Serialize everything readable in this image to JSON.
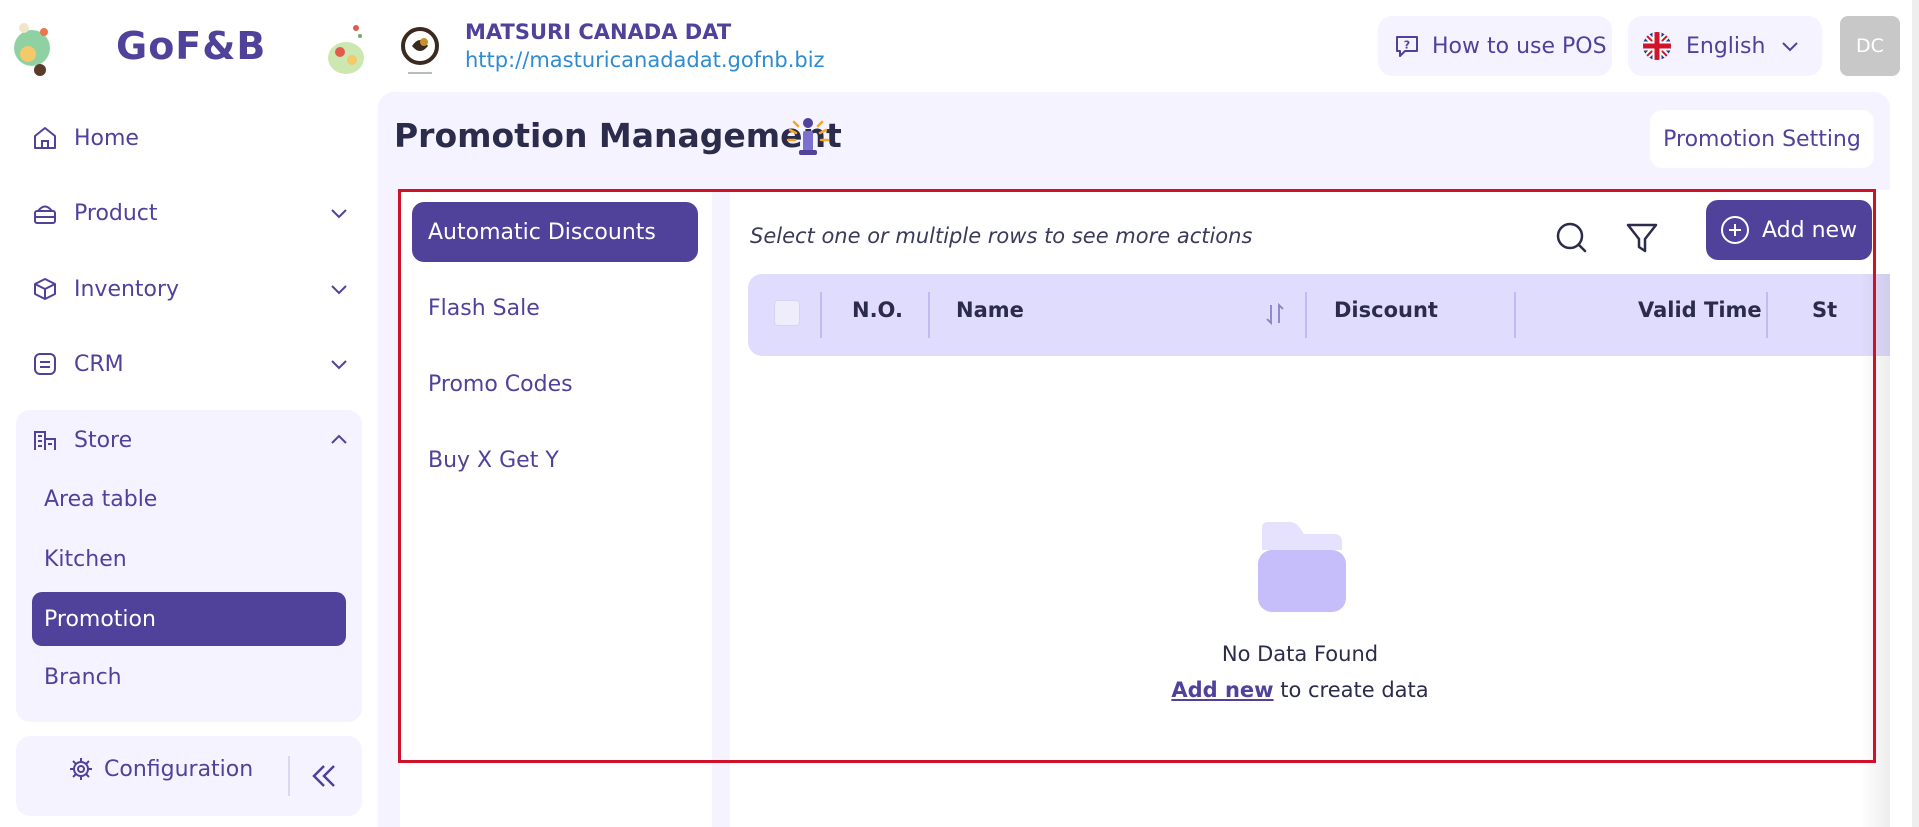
{
  "header": {
    "logo_text": "GoF&B",
    "store_name": "MATSURI CANADA DAT",
    "store_url": "http://masturicanadadat.gofnb.biz",
    "howto_label": "How to use POS",
    "language": "English",
    "avatar_initials": "DC"
  },
  "sidebar": {
    "items": [
      {
        "label": "Home",
        "icon": "home-icon"
      },
      {
        "label": "Product",
        "icon": "product-icon"
      },
      {
        "label": "Inventory",
        "icon": "inventory-icon"
      },
      {
        "label": "CRM",
        "icon": "crm-icon"
      },
      {
        "label": "Store",
        "icon": "store-icon"
      }
    ],
    "store_sub": [
      "Area table",
      "Kitchen",
      "Promotion",
      "Branch"
    ],
    "active_sub": "Promotion",
    "config_label": "Configuration"
  },
  "main": {
    "title": "Promotion Management",
    "setting_button": "Promotion Setting",
    "tabs": [
      "Automatic Discounts",
      "Flash Sale",
      "Promo Codes",
      "Buy X Get Y"
    ],
    "hint": "Select one or multiple rows to see more actions",
    "add_button": "Add new",
    "columns": [
      "N.O.",
      "Name",
      "Discount",
      "Valid Time",
      "St"
    ],
    "empty_title": "No Data Found",
    "empty_link": "Add new",
    "empty_suffix": " to create data"
  },
  "colors": {
    "brand": "#50429b",
    "url": "#2e8bd1",
    "highlight": "#d0112b",
    "panel_bg": "#f5f3ff",
    "table_header": "#e0dcfd"
  }
}
